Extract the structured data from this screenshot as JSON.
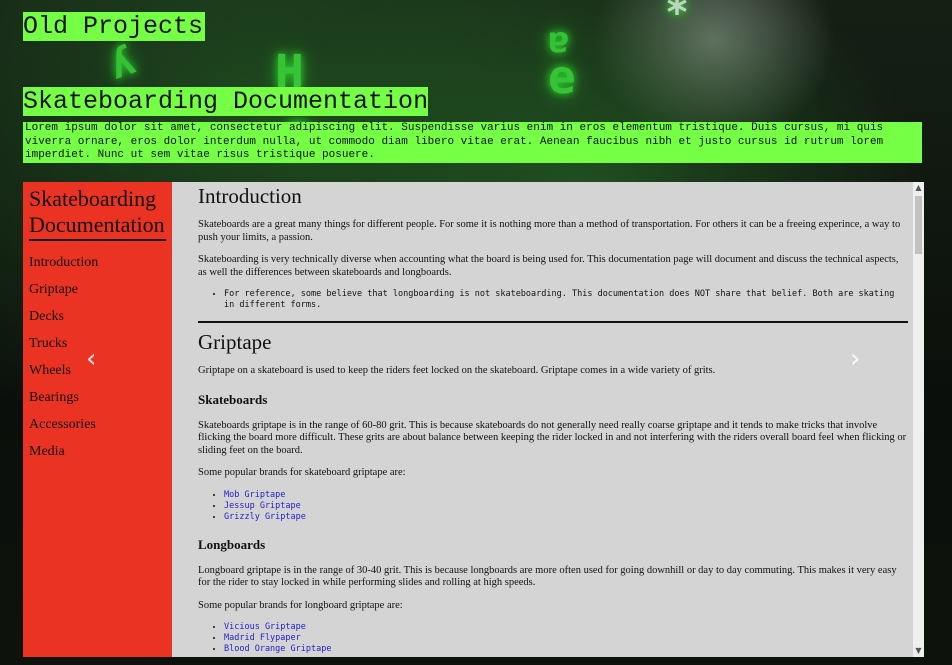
{
  "page": {
    "title": "Old Projects",
    "doc_title": "Skateboarding Documentation",
    "intro": "Lorem ipsum dolor sit amet, consectetur adipiscing elit. Suspendisse varius enim in eros elementum tristique. Duis cursus, mi quis viverra ornare, eros dolor interdum nulla, ut commodo diam libero vitae erat. Aenean faucibus nibh et justo cursus id rutrum lorem imperdiet. Nunc ut sem vitae risus tristique posuere."
  },
  "nav": {
    "header": "Skateboarding Documentation",
    "items": [
      "Introduction",
      "Griptape",
      "Decks",
      "Trucks",
      "Wheels",
      "Bearings",
      "Accessories",
      "Media"
    ]
  },
  "carousel": {
    "prev_icon": "chevron-left-icon",
    "next_icon": "chevron-right-icon"
  },
  "main": {
    "introduction": {
      "title": "Introduction",
      "p1": "Skateboards are a great many things for different people. For some it is nothing more than a method of transportation. For others it can be a freeing experince, a way to push your limits, a passion.",
      "p2": "Skateboarding is very technically diverse when accounting what the board is being used for. This documentation page will document and discuss the technical aspects, as well the differences between skateboards and longboards.",
      "note": "For reference, some believe that longboarding is not skateboarding. This documentation does NOT share that belief. Both are skating in different forms."
    },
    "griptape": {
      "title": "Griptape",
      "p1": "Griptape on a skateboard is used to keep the riders feet locked on the skateboard. Griptape comes in a wide variety of grits.",
      "skate_title": "Skateboards",
      "skate_p": "Skateboards griptape is in the range of 60-80 grit. This is because skateboards do not generally need really coarse griptape and it tends to make tricks that involve flicking the board more difficult. These grits are about balance between keeping the rider locked in and not interfering with the riders overall board feel when flicking or sliding feet on the board.",
      "skate_brands_intro": "Some popular brands for skateboard griptape are:",
      "skate_brands": [
        "Mob Griptape",
        "Jessup Griptape",
        "Grizzly Griptape"
      ],
      "long_title": "Longboards",
      "long_p": "Longboard griptape is in the range of 30-40 grit. This is because longboards are more often used for going downhill or day to day commuting. This makes it very easy for the rider to stay locked in while performing slides and rolling at high speeds.",
      "long_brands_intro": "Some popular brands for longboard griptape are:",
      "long_brands": [
        "Vicious Griptape",
        "Madrid Flypaper",
        "Blood Orange Griptape"
      ]
    }
  },
  "colors": {
    "accent_green": "#75ff45",
    "nav_red": "#ea3322",
    "main_bg": "#d4d4d4",
    "link_blue": "#2222cc"
  }
}
